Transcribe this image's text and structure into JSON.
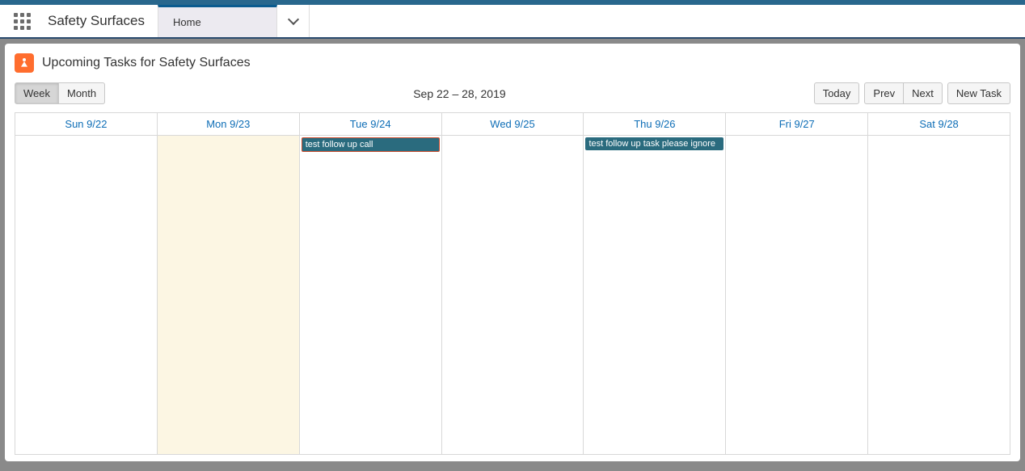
{
  "topbar": {
    "app_name": "Safety Surfaces",
    "tab_home": "Home"
  },
  "card": {
    "title": "Upcoming Tasks for Safety Surfaces"
  },
  "toolbar": {
    "view_week": "Week",
    "view_month": "Month",
    "date_range": "Sep 22 – 28, 2019",
    "btn_today": "Today",
    "btn_prev": "Prev",
    "btn_next": "Next",
    "btn_new_task": "New Task"
  },
  "calendar": {
    "days": [
      {
        "header": "Sun 9/22",
        "today": false,
        "events": []
      },
      {
        "header": "Mon 9/23",
        "today": true,
        "events": []
      },
      {
        "header": "Tue 9/24",
        "today": false,
        "events": [
          {
            "label": "test follow up call",
            "highlighted": true
          }
        ]
      },
      {
        "header": "Wed 9/25",
        "today": false,
        "events": []
      },
      {
        "header": "Thu 9/26",
        "today": false,
        "events": [
          {
            "label": "test follow up task please ignore",
            "highlighted": false
          }
        ]
      },
      {
        "header": "Fri 9/27",
        "today": false,
        "events": []
      },
      {
        "header": "Sat 9/28",
        "today": false,
        "events": []
      }
    ]
  }
}
